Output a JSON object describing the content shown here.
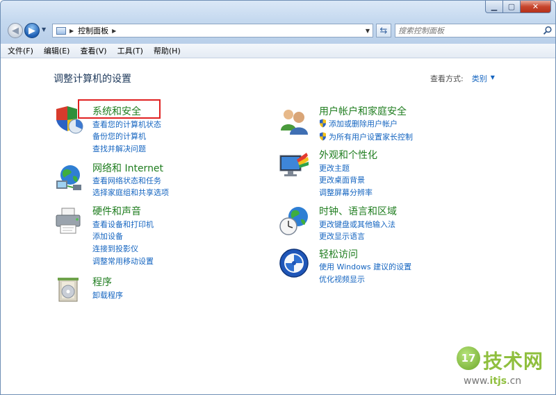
{
  "address": {
    "crumb": "控制面板"
  },
  "search": {
    "placeholder": "搜索控制面板"
  },
  "menu": [
    "文件(F)",
    "编辑(E)",
    "查看(V)",
    "工具(T)",
    "帮助(H)"
  ],
  "page": {
    "title": "调整计算机的设置",
    "view_by_label": "查看方式:",
    "view_by_value": "类别"
  },
  "categories": [
    {
      "title": "系统和安全",
      "icon": "shield-pie-icon",
      "links": [
        "查看您的计算机状态",
        "备份您的计算机",
        "查找并解决问题"
      ]
    },
    {
      "title": "网络和 Internet",
      "icon": "network-globe-icon",
      "links": [
        "查看网络状态和任务",
        "选择家庭组和共享选项"
      ]
    },
    {
      "title": "硬件和声音",
      "icon": "printer-icon",
      "links": [
        "查看设备和打印机",
        "添加设备",
        "连接到投影仪",
        "调整常用移动设置"
      ]
    },
    {
      "title": "程序",
      "icon": "programs-box-icon",
      "links": [
        "卸载程序"
      ]
    },
    {
      "title": "用户帐户和家庭安全",
      "icon": "users-icon",
      "links": [
        "添加或删除用户帐户",
        "为所有用户设置家长控制"
      ]
    },
    {
      "title": "外观和个性化",
      "icon": "monitor-palette-icon",
      "links": [
        "更改主题",
        "更改桌面背景",
        "调整屏幕分辨率"
      ]
    },
    {
      "title": "时钟、语言和区域",
      "icon": "clock-globe-icon",
      "links": [
        "更改键盘或其他输入法",
        "更改显示语言"
      ]
    },
    {
      "title": "轻松访问",
      "icon": "ease-of-access-icon",
      "links": [
        "使用 Windows 建议的设置",
        "优化视频显示"
      ]
    }
  ],
  "watermark": {
    "badge": "17",
    "text": "技术网",
    "url_prefix": "www.",
    "url_domain": "itjs",
    "url_suffix": ".cn"
  },
  "colors": {
    "category_title": "#1f7d1f",
    "link": "#1565c0",
    "highlight": "#e02020"
  }
}
